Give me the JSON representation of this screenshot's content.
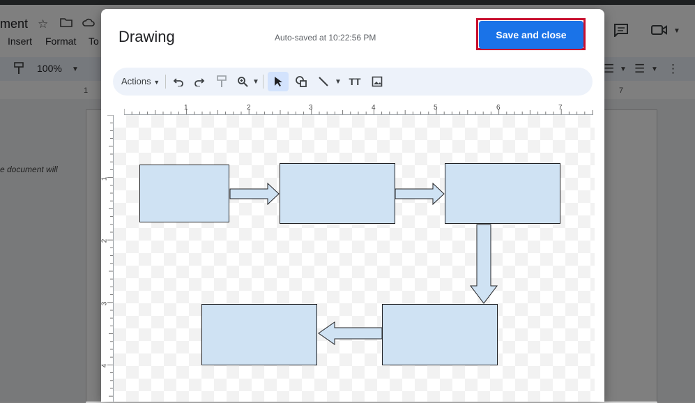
{
  "background_doc": {
    "title_fragment": "ment",
    "menu": [
      "Insert",
      "Format",
      "To"
    ],
    "zoom": "100%",
    "ruler_numbers": [
      "1",
      "7"
    ],
    "doc_text": "e document will"
  },
  "dialog": {
    "title": "Drawing",
    "autosave": "Auto-saved at 10:22:56 PM",
    "save_label": "Save and close",
    "toolbar": {
      "actions_label": "Actions",
      "icons": [
        "undo-icon",
        "redo-icon",
        "paint-format-icon",
        "zoom-icon",
        "select-icon",
        "shape-icon",
        "line-icon",
        "text-box-icon",
        "image-icon"
      ]
    },
    "hruler_numbers": [
      "1",
      "2",
      "3",
      "4",
      "5",
      "6",
      "7"
    ],
    "vruler_numbers": [
      "1",
      "2",
      "3",
      "4"
    ]
  },
  "colors": {
    "accent": "#1a73e8",
    "highlight": "#c8102e",
    "shape_fill": "#cfe2f3"
  }
}
